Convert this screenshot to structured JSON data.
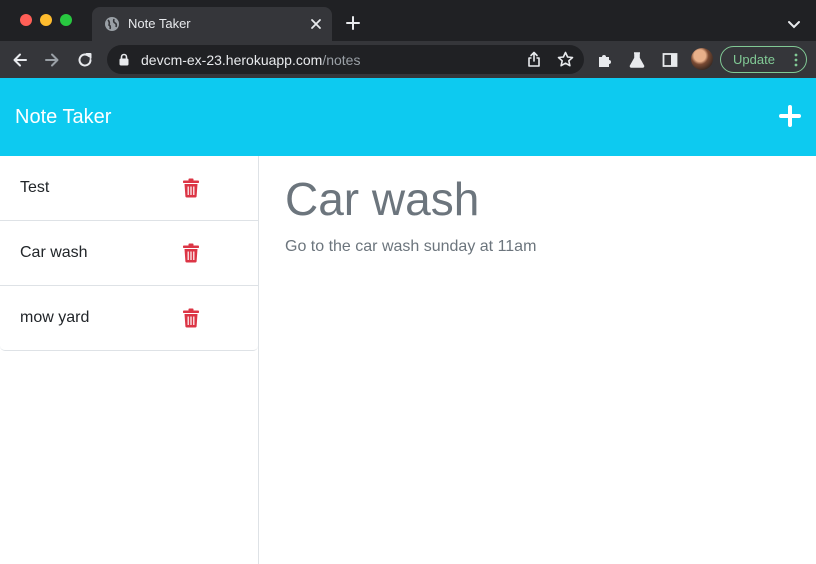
{
  "browser": {
    "tab": {
      "title": "Note Taker"
    },
    "address": {
      "host": "devcm-ex-23.herokuapp.com",
      "path": "/notes"
    },
    "update_label": "Update"
  },
  "app": {
    "title": "Note Taker",
    "notes": [
      {
        "title": "Test"
      },
      {
        "title": "Car wash"
      },
      {
        "title": "mow yard"
      }
    ],
    "active_note": {
      "title": "Car wash",
      "text": "Go to the car wash sunday at 11am"
    }
  },
  "colors": {
    "header": "#0dcaf0",
    "delete_icon": "#dc3545",
    "update_accent": "#81c995"
  },
  "icons": {
    "add": "plus-icon",
    "delete": "trash-icon",
    "tab_favicon": "globe-icon"
  }
}
